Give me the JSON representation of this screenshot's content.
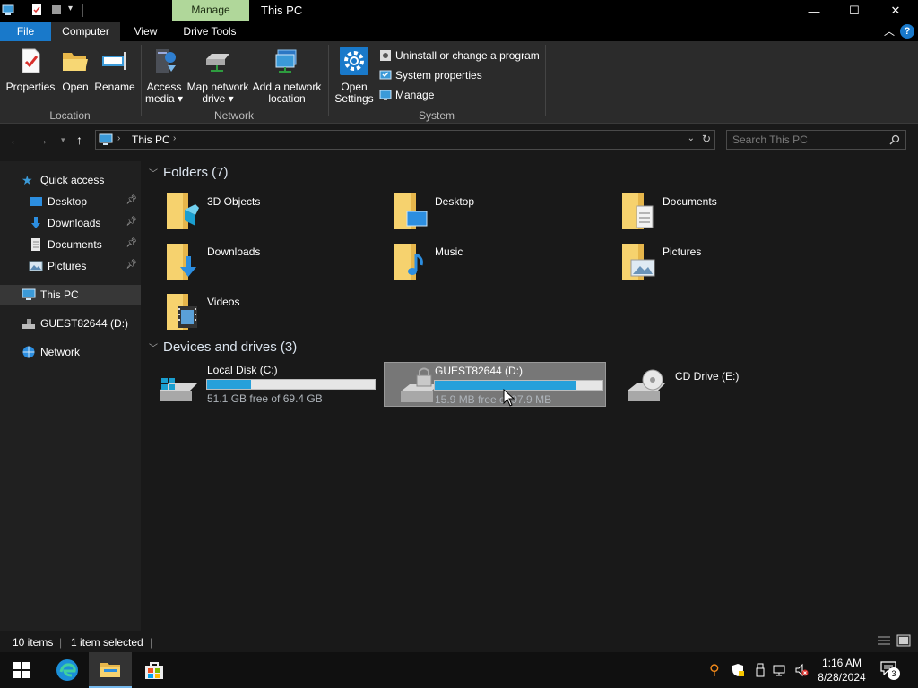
{
  "window": {
    "title": "This PC",
    "context_tab": "Manage",
    "buttons": {
      "minimize": "—",
      "maximize": "☐",
      "close": "✕"
    }
  },
  "ribbon_tabs": [
    {
      "label": "File"
    },
    {
      "label": "Computer"
    },
    {
      "label": "View"
    },
    {
      "label": "Drive Tools"
    }
  ],
  "help": "?",
  "ribbon": {
    "location": {
      "label": "Location",
      "buttons": [
        "Properties",
        "Open",
        "Rename"
      ]
    },
    "network": {
      "label": "Network",
      "access_media": [
        "Access",
        "media ▾"
      ],
      "map_drive": [
        "Map network",
        "drive ▾"
      ],
      "add_location": [
        "Add a network",
        "location"
      ]
    },
    "system": {
      "label": "System",
      "open_settings": [
        "Open",
        "Settings"
      ],
      "uninstall": "Uninstall or change a program",
      "system_properties": "System properties",
      "manage": "Manage"
    }
  },
  "address": {
    "path": "This PC",
    "search_placeholder": "Search This PC"
  },
  "nav": {
    "quick_access": "Quick access",
    "pinned": [
      "Desktop",
      "Downloads",
      "Documents",
      "Pictures"
    ],
    "this_pc": "This PC",
    "guest_drive": "GUEST82644 (D:)",
    "network": "Network"
  },
  "folders_header": "Folders (7)",
  "folders": [
    "3D Objects",
    "Desktop",
    "Documents",
    "Downloads",
    "Music",
    "Pictures",
    "Videos"
  ],
  "devices_header": "Devices and drives (3)",
  "drives": [
    {
      "name": "Local Disk (C:)",
      "free": "51.1 GB free of 69.4 GB",
      "used_fraction": 0.26
    },
    {
      "name": "GUEST82644 (D:)",
      "free": "15.9 MB free of 97.9 MB",
      "used_fraction": 0.84
    },
    {
      "name": "CD Drive (E:)"
    }
  ],
  "status": {
    "items": "10 items",
    "selected": "1 item selected"
  },
  "clock": {
    "time": "1:16 AM",
    "date": "8/28/2024"
  },
  "notification_count": "3",
  "colors": {
    "accent": "#1979ca",
    "drive_bar": "#26a0da",
    "context_tab": "#b0d79a"
  }
}
